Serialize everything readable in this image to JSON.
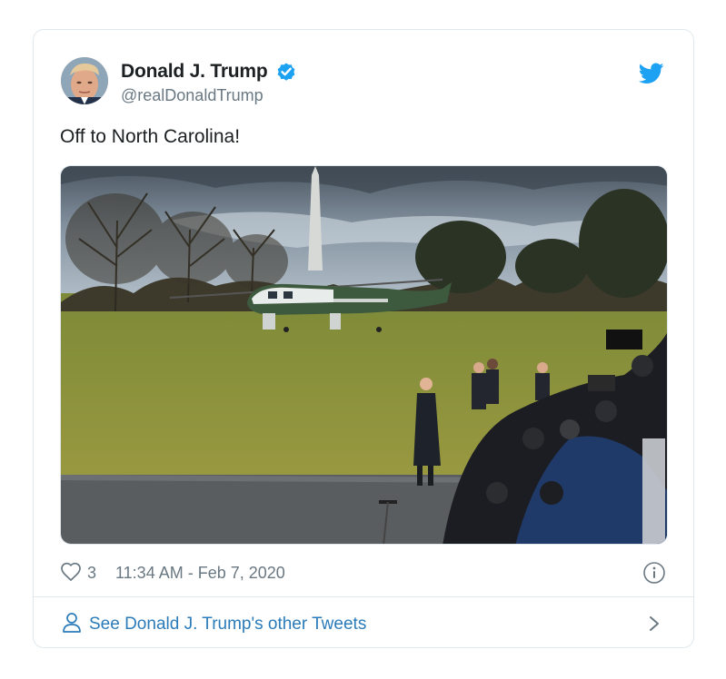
{
  "user": {
    "display_name": "Donald J. Trump",
    "handle": "@realDonaldTrump",
    "verified": true,
    "avatar_icon": "profile-photo"
  },
  "tweet": {
    "text": "Off to North Carolina!",
    "image_icon": "photo-helicopter-white-house-lawn-press"
  },
  "meta": {
    "like_count": "3",
    "timestamp": "11:34 AM - Feb 7, 2020"
  },
  "footer": {
    "link_text": "See Donald J. Trump's other Tweets"
  },
  "colors": {
    "twitter_blue": "#1da1f2",
    "link_blue": "#2b7bb9",
    "muted_gray": "#697882",
    "border": "#e1e8ed"
  }
}
